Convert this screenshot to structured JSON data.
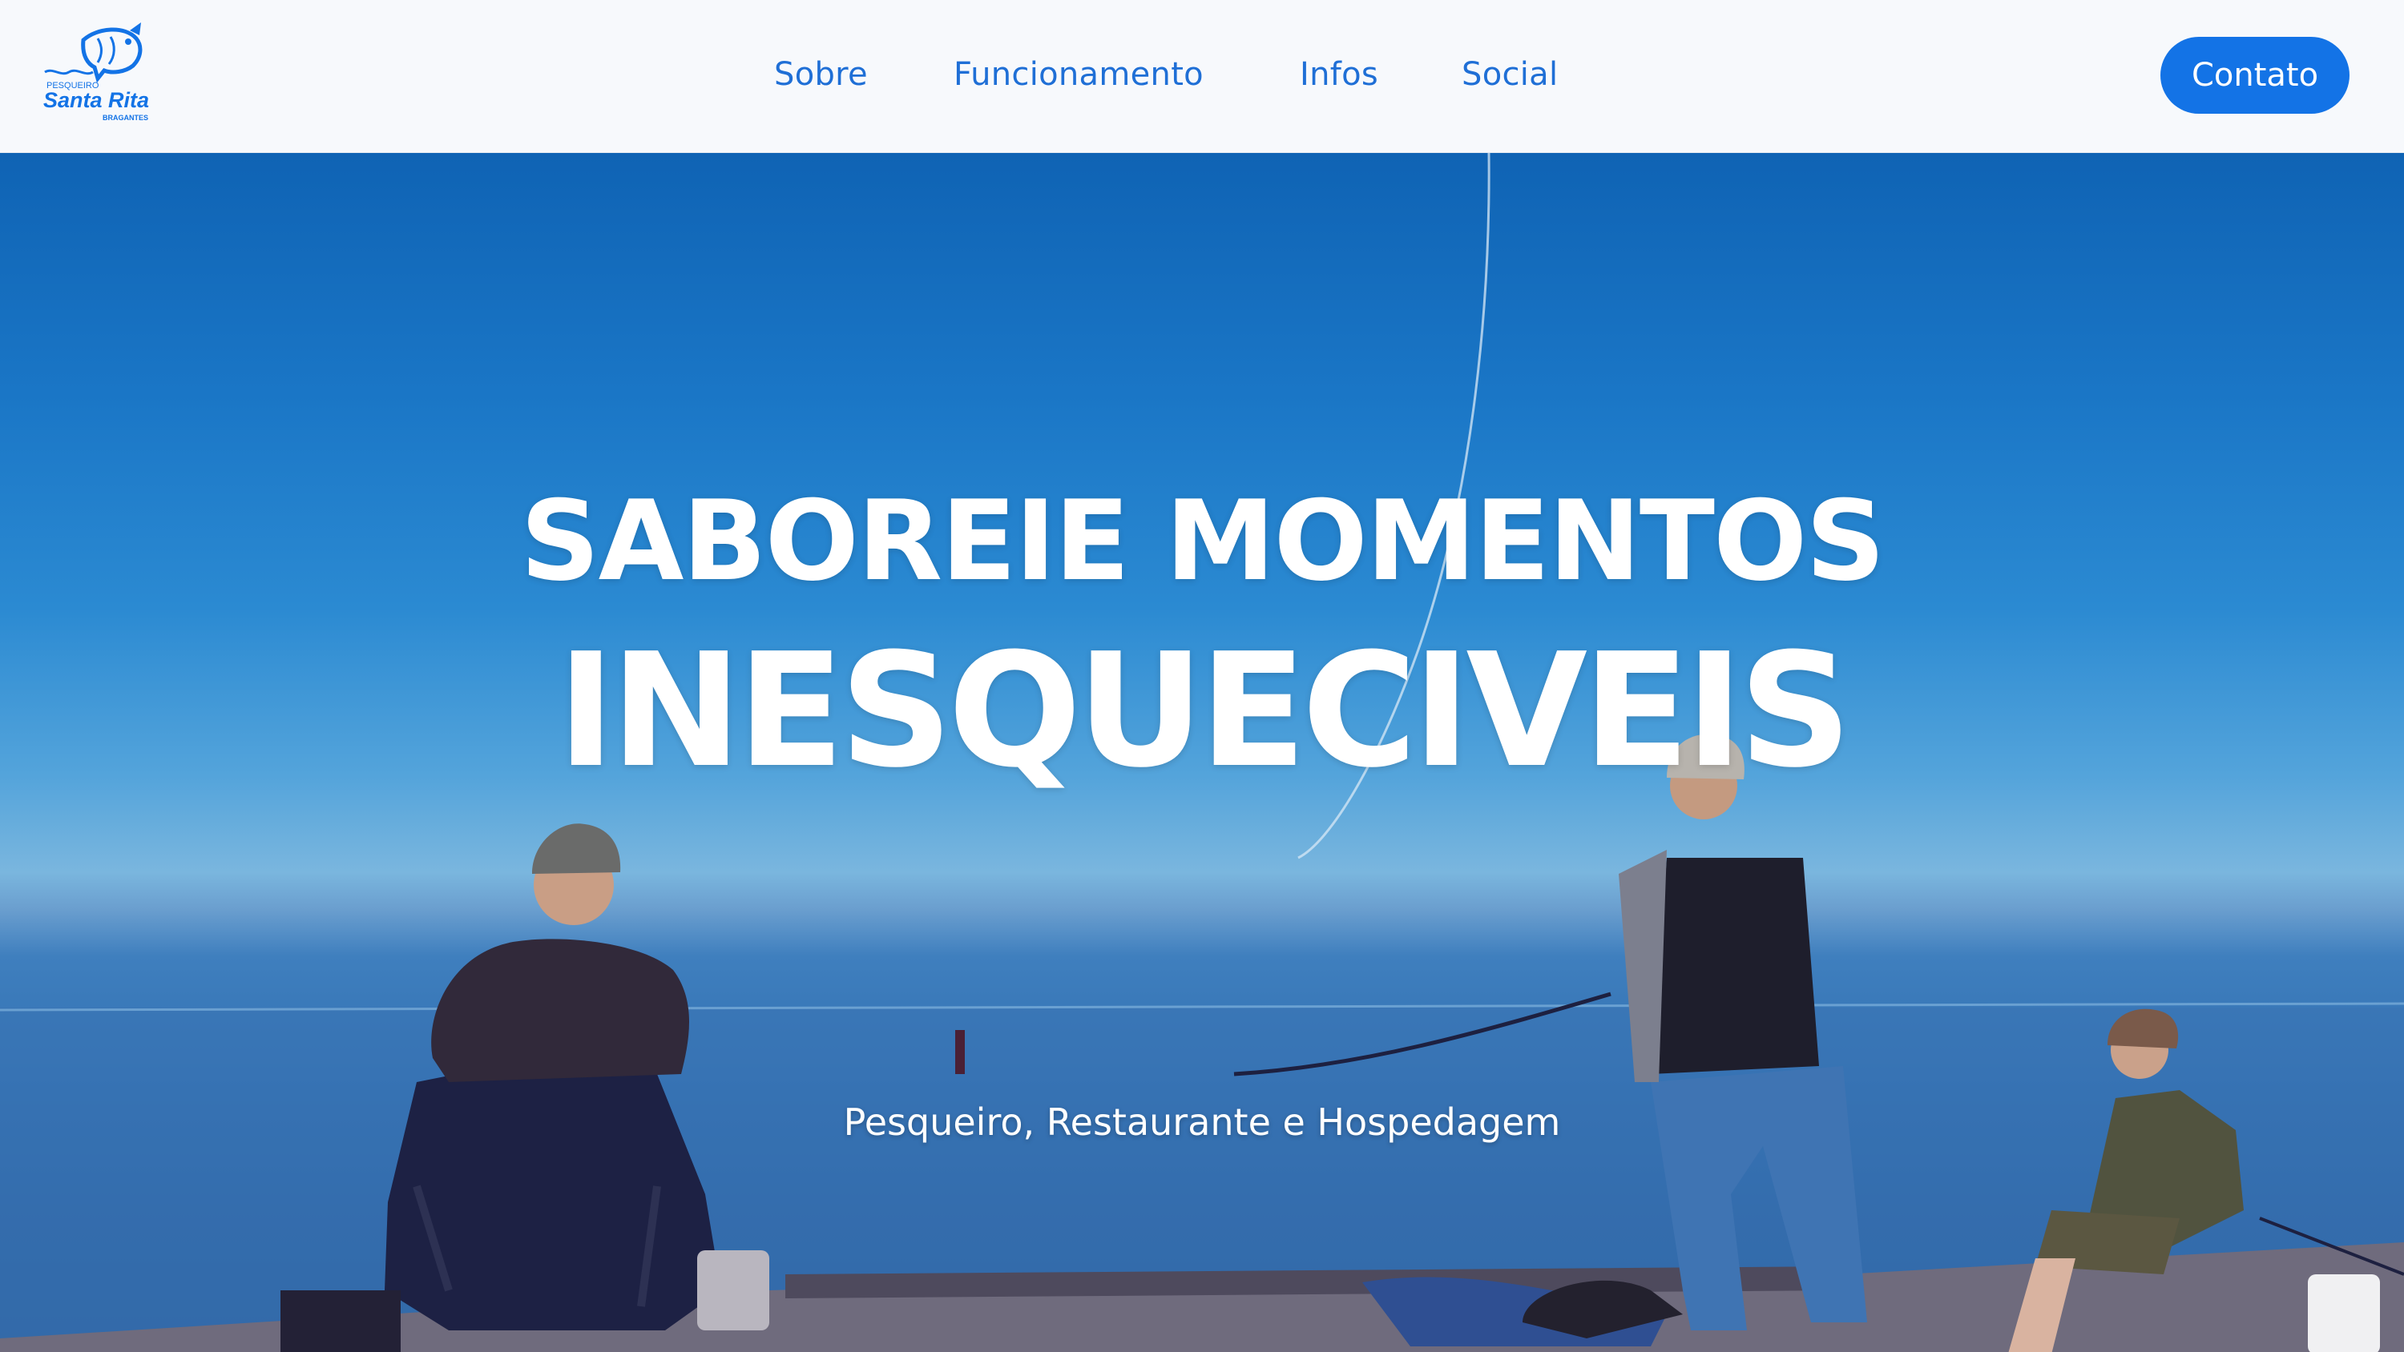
{
  "brand": {
    "logo_top_text": "PESQUEIRO",
    "logo_name": "Santa Rita",
    "logo_bottom_text": "BRAGANTES",
    "logo_color": "#1373e6"
  },
  "nav": {
    "items": [
      {
        "label": "Sobre"
      },
      {
        "label": "Funcionamento"
      },
      {
        "label": "Infos"
      },
      {
        "label": "Social"
      }
    ],
    "link_color": "#1f6fd6"
  },
  "header": {
    "contact_label": "Contato",
    "contact_color": "#1373e6",
    "background": "#f7f9fc"
  },
  "hero": {
    "title_line1": "SABOREIE MOMENTOS",
    "title_line2": "INESQUECIVEIS",
    "subtitle": "Pesqueiro, Restaurante e Hospedagem",
    "image_description_icon": "fishermen-photo"
  }
}
